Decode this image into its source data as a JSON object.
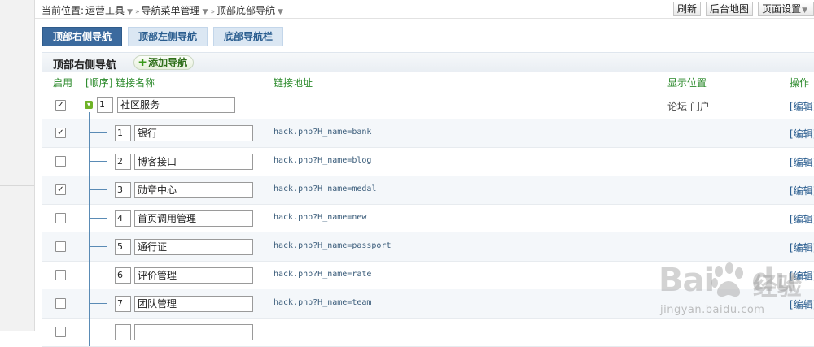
{
  "breadcrumb": {
    "prefix": "当前位置:",
    "items": [
      "运营工具",
      "导航菜单管理",
      "顶部底部导航"
    ]
  },
  "topbar_buttons": [
    "刷新",
    "后台地图",
    "页面设置"
  ],
  "tabs": [
    {
      "label": "顶部右侧导航",
      "active": true
    },
    {
      "label": "顶部左侧导航",
      "active": false
    },
    {
      "label": "底部导航栏",
      "active": false
    }
  ],
  "section": {
    "title": "顶部右侧导航",
    "add_label": "添加导航"
  },
  "columns": {
    "enable": "启用",
    "order_name": "[顺序] 链接名称",
    "url": "链接地址",
    "position": "显示位置",
    "action": "操作"
  },
  "rows": [
    {
      "checked": true,
      "order": "1",
      "name": "社区服务",
      "url": "",
      "position": "论坛  门户",
      "edit": "[编辑]",
      "parent": true
    },
    {
      "checked": true,
      "order": "1",
      "name": "银行",
      "url": "hack.php?H_name=bank",
      "position": "",
      "edit": "[编辑]"
    },
    {
      "checked": false,
      "order": "2",
      "name": "博客接口",
      "url": "hack.php?H_name=blog",
      "position": "",
      "edit": "[编辑]"
    },
    {
      "checked": true,
      "order": "3",
      "name": "勋章中心",
      "url": "hack.php?H_name=medal",
      "position": "",
      "edit": "[编辑]"
    },
    {
      "checked": false,
      "order": "4",
      "name": "首页调用管理",
      "url": "hack.php?H_name=new",
      "position": "",
      "edit": "[编辑]"
    },
    {
      "checked": false,
      "order": "5",
      "name": "通行证",
      "url": "hack.php?H_name=passport",
      "position": "",
      "edit": "[编辑]"
    },
    {
      "checked": false,
      "order": "6",
      "name": "评价管理",
      "url": "hack.php?H_name=rate",
      "position": "",
      "edit": "[编辑]"
    },
    {
      "checked": false,
      "order": "7",
      "name": "团队管理",
      "url": "hack.php?H_name=team",
      "position": "",
      "edit": "[编辑]"
    }
  ],
  "watermark": {
    "brand": "Bai",
    "brand_du": "du",
    "cn": "经验",
    "url": "jingyan.baidu.com"
  },
  "colors": {
    "tab_active": "#3b6a9e",
    "tab_inactive": "#dbe7f3",
    "header_green": "#2b8a2b",
    "link_blue": "#2a5d8f"
  }
}
